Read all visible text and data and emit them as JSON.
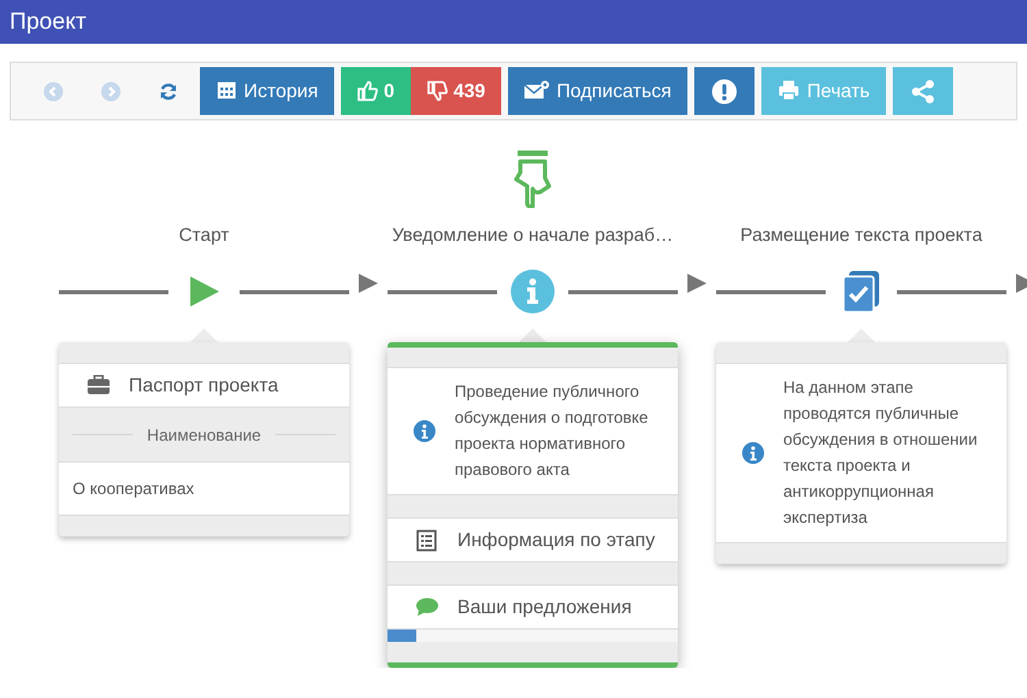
{
  "window": {
    "title": "Проект"
  },
  "toolbar": [
    {
      "kind": "nav",
      "disabled": true
    },
    {
      "kind": "nav",
      "disabled": true
    },
    {
      "kind": "nav",
      "disabled": false
    },
    {
      "kind": "button",
      "label": "История",
      "color": "#337ab7"
    },
    {
      "kind": "vote",
      "buttons": [
        {
          "label": "0",
          "color": "#2dbe83"
        },
        {
          "label": "439",
          "color": "#d9534f"
        }
      ]
    },
    {
      "kind": "button",
      "label": "Подписаться",
      "color": "#337ab7"
    },
    {
      "kind": "button",
      "color": "#337ab7"
    },
    {
      "kind": "button",
      "label": "Печать",
      "color": "#5bc0de"
    },
    {
      "kind": "button",
      "color": "#5bc0de"
    }
  ],
  "stages": [
    {
      "label": "Старт",
      "current": false,
      "active": false,
      "card": {
        "rows": [
          {
            "kind": "link",
            "text": "Паспорт проекта"
          },
          {
            "kind": "section",
            "text": "Наименование"
          },
          {
            "kind": "text",
            "text": "О кооперативах"
          }
        ]
      }
    },
    {
      "label": "Уведомление о начале разраб…",
      "current": true,
      "active": true,
      "card": {
        "rows": [
          {
            "kind": "info",
            "text": "Проведение публичного обсуждения о подготовке проекта нормативного правового акта"
          },
          {
            "kind": "link",
            "text": "Информация по этапу"
          },
          {
            "kind": "link",
            "text": "Ваши предложения"
          }
        ],
        "progress": {
          "level": 0.1
        }
      }
    },
    {
      "label": "Размещение текста проекта",
      "current": false,
      "active": false,
      "card": {
        "rows": [
          {
            "kind": "info",
            "text": "На данном этапе проводятся публичные обсуждения в отношении текста проекта и антикоррупционная экспертиза"
          }
        ]
      }
    }
  ]
}
